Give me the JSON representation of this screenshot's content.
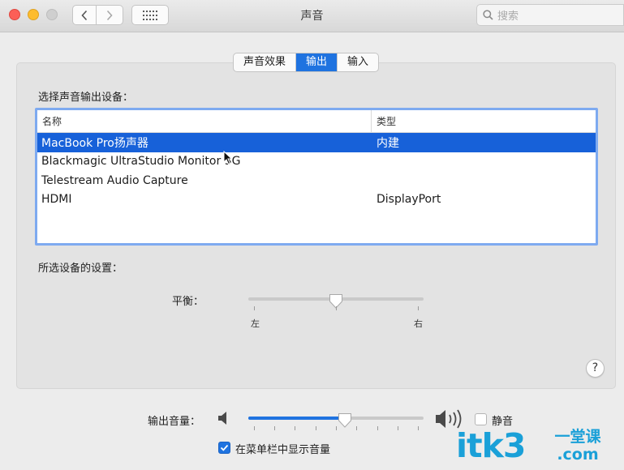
{
  "window": {
    "title": "声音",
    "search_placeholder": "搜索"
  },
  "tabs": [
    {
      "label": "声音效果",
      "active": false
    },
    {
      "label": "输出",
      "active": true
    },
    {
      "label": "输入",
      "active": false
    }
  ],
  "output": {
    "section_label": "选择声音输出设备：",
    "columns": {
      "name": "名称",
      "type": "类型"
    },
    "devices": [
      {
        "name": "MacBook Pro扬声器",
        "type": "内建",
        "selected": true
      },
      {
        "name": "Blackmagic UltraStudio Monitor 3G",
        "type": "",
        "selected": false
      },
      {
        "name": "Telestream Audio Capture",
        "type": "",
        "selected": false
      },
      {
        "name": "HDMI",
        "type": "DisplayPort",
        "selected": false
      }
    ]
  },
  "settings": {
    "section_label": "所选设备的设置：",
    "balance_label": "平衡：",
    "balance_left": "左",
    "balance_right": "右",
    "balance_value": 0.5
  },
  "help_label": "?",
  "volume": {
    "label": "输出音量：",
    "value": 0.55,
    "mute_label": "静音",
    "muted": false
  },
  "menubar": {
    "show_label": "在菜单栏中显示音量",
    "checked": true
  },
  "watermark": {
    "text": "itk3",
    "domain": ".com",
    "tagline": "一堂课"
  },
  "colors": {
    "accent": "#1f73e0",
    "selection": "#1761d9",
    "watermark": "#1aa0d8"
  }
}
